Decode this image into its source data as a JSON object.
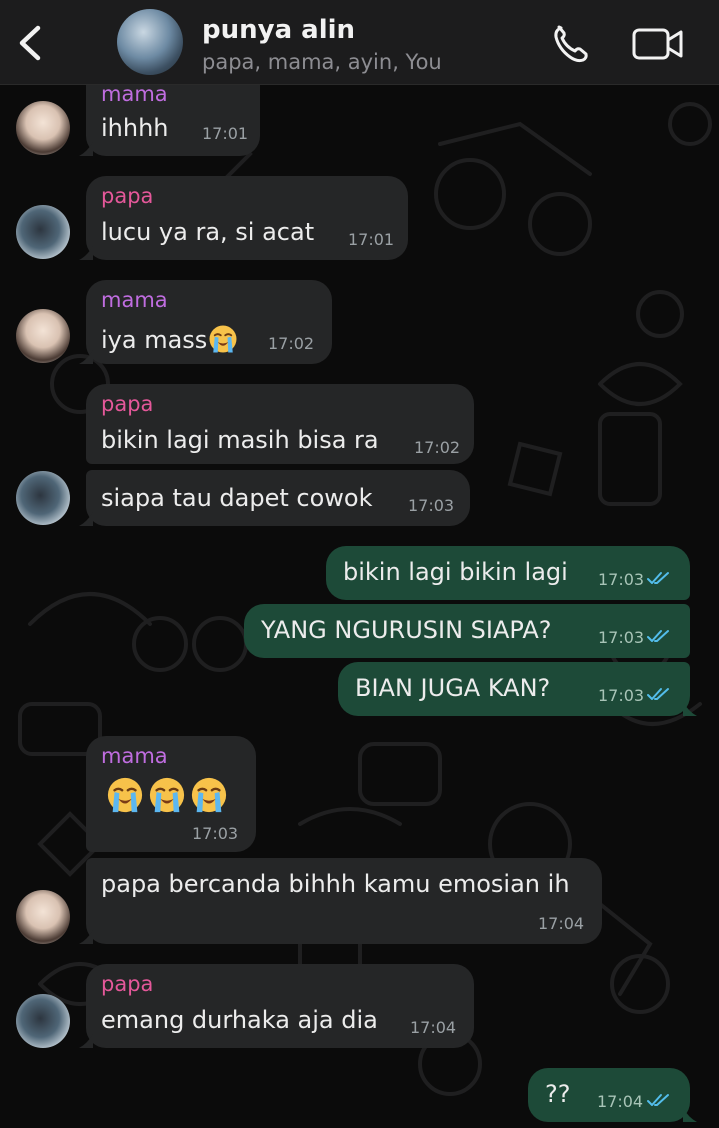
{
  "header": {
    "title": "punya alin",
    "subtitle": "papa, mama, ayin, You",
    "avatar_caption": "",
    "icons": [
      "back-chevron-icon",
      "phone-icon",
      "video-camera-icon"
    ]
  },
  "colors": {
    "background": "#0b0b0b",
    "header": "#1c1c1d",
    "incoming_bubble": "#252627",
    "outgoing_bubble": "#1d4a38",
    "mama_name": "#c06de0",
    "papa_name": "#e5589a",
    "read_ticks": "#53bdeb"
  },
  "messages": [
    {
      "sender": "mama",
      "text": "ihhhh",
      "time": "17:01"
    },
    {
      "sender": "papa",
      "text": "lucu ya ra, si acat",
      "time": "17:01"
    },
    {
      "sender": "mama",
      "text": "iya mass",
      "emoji": "loudly-crying-face",
      "time": "17:02"
    },
    {
      "sender": "papa",
      "text": "bikin lagi masih bisa ra",
      "time": "17:02"
    },
    {
      "sender": "",
      "text": "siapa tau dapet cowok",
      "time": "17:03"
    },
    {
      "sender": "You",
      "text": "bikin lagi bikin lagi",
      "time": "17:03",
      "status": "read"
    },
    {
      "sender": "You",
      "text": "YANG NGURUSIN SIAPA?",
      "time": "17:03",
      "status": "read"
    },
    {
      "sender": "You",
      "text": "BIAN JUGA KAN?",
      "time": "17:03",
      "status": "read"
    },
    {
      "sender": "mama",
      "text": "",
      "emoji": "loudly-crying-face x3",
      "time": "17:03"
    },
    {
      "sender": "",
      "text": "papa bercanda bihhh kamu emosian ih",
      "time": "17:04"
    },
    {
      "sender": "papa",
      "text": "emang durhaka aja dia",
      "time": "17:04"
    },
    {
      "sender": "You",
      "text": "??",
      "time": "17:04",
      "status": "read"
    }
  ]
}
